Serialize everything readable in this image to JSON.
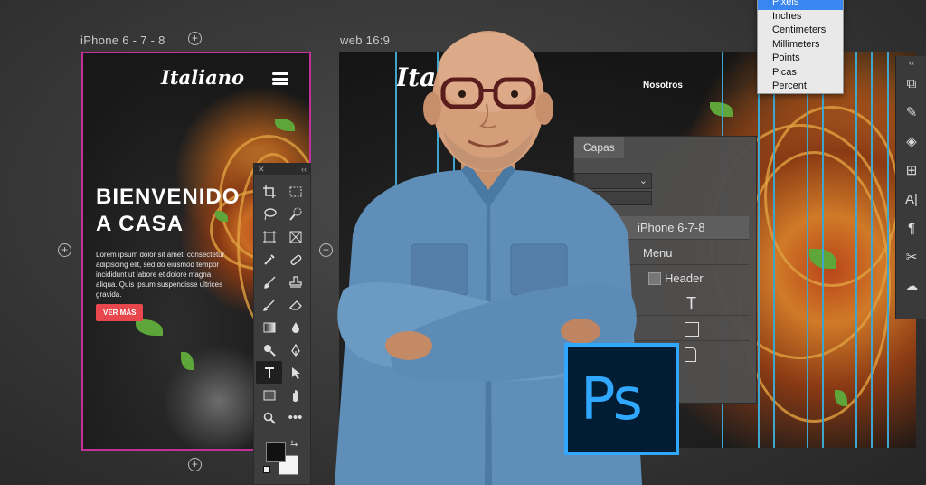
{
  "artboards": {
    "phone_label": "iPhone 6 - 7 - 8",
    "web_label": "web 16:9"
  },
  "iphone": {
    "logo": "Italiano",
    "hero_title": "BIENVENIDO\nA CASA",
    "hero_text": "Lorem ipsum dolor sit amet, consectetur adipiscing elit, sed do eiusmod tempor incididunt ut labore et dolore magna aliqua. Quis ipsum suspendisse ultrices gravida.",
    "cta": "VER MÁS"
  },
  "web": {
    "logo": "Italiano",
    "nav_item": "Nosotros"
  },
  "layers_panel": {
    "tab": "Capas",
    "rows": [
      "iPhone 6-7-8",
      "Menu",
      "Header",
      "T",
      "",
      ""
    ]
  },
  "units_menu": {
    "items": [
      "Pixels",
      "Inches",
      "Centimeters",
      "Millimeters",
      "Points",
      "Picas",
      "Percent"
    ],
    "selected_index": 0
  },
  "tools": [
    "crop-icon",
    "marquee-icon",
    "lasso-icon",
    "quick-select-icon",
    "frame-icon",
    "slice-icon",
    "eyedropper-icon",
    "healing-icon",
    "brush-icon",
    "stamp-icon",
    "history-brush-icon",
    "eraser-icon",
    "gradient-icon",
    "blur-icon",
    "dodge-icon",
    "pen-icon",
    "type-icon",
    "path-select-icon",
    "rectangle-icon",
    "hand-icon",
    "zoom-icon",
    "more-icon"
  ],
  "active_tool": "type-icon",
  "brand": {
    "ps_logo": "Ps",
    "ps_blue": "#31a8ff",
    "ps_dark": "#001d34",
    "cta_red": "#e8484d",
    "artboard_border": "#c0329a",
    "guide_color": "#3fa5cc"
  }
}
